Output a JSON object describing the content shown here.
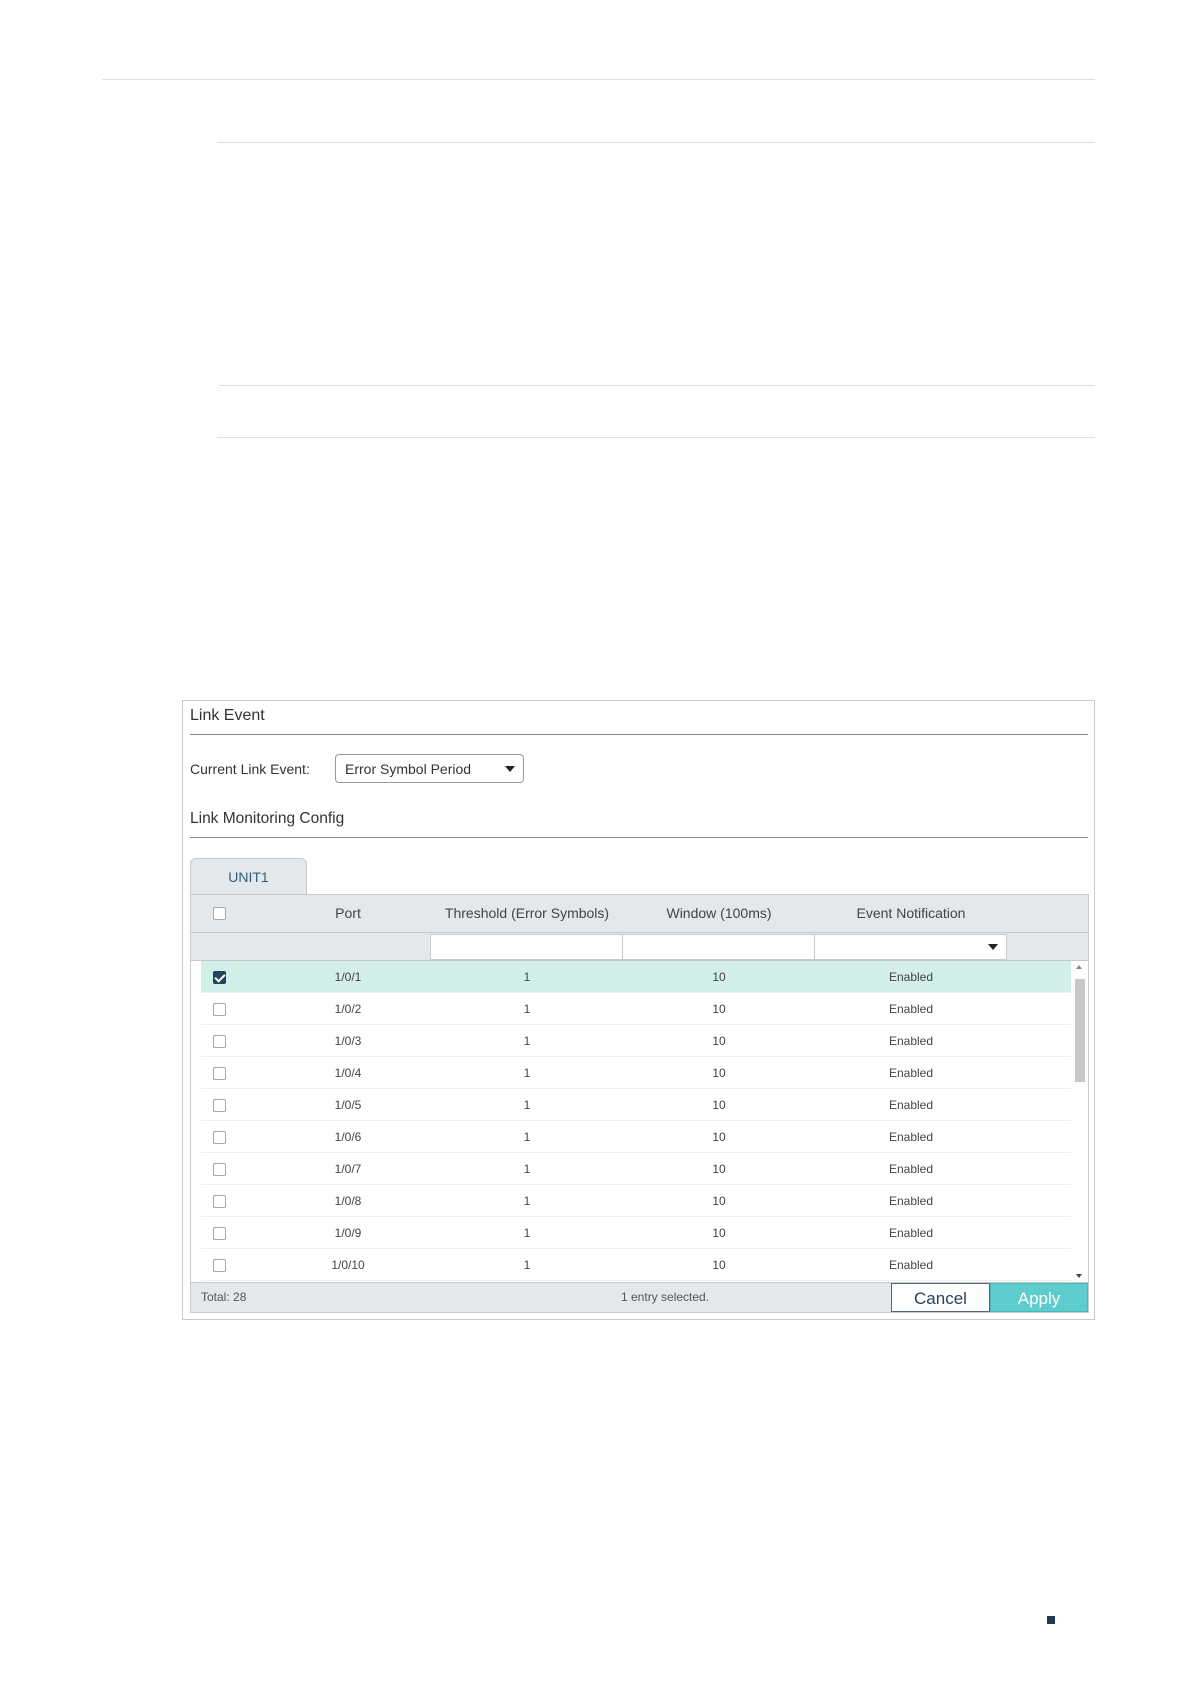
{
  "panel": {
    "title": "Link Event",
    "current_link_event": {
      "label": "Current Link Event:",
      "value": "Error Symbol Period"
    },
    "config_title": "Link Monitoring Config"
  },
  "tab": {
    "label": "UNIT1"
  },
  "table": {
    "headers": {
      "port": "Port",
      "threshold": "Threshold (Error Symbols)",
      "window": "Window (100ms)",
      "notification": "Event Notification"
    },
    "rows": [
      {
        "port": "1/0/1",
        "threshold": "1",
        "window": "10",
        "notification": "Enabled",
        "checked": true
      },
      {
        "port": "1/0/2",
        "threshold": "1",
        "window": "10",
        "notification": "Enabled",
        "checked": false
      },
      {
        "port": "1/0/3",
        "threshold": "1",
        "window": "10",
        "notification": "Enabled",
        "checked": false
      },
      {
        "port": "1/0/4",
        "threshold": "1",
        "window": "10",
        "notification": "Enabled",
        "checked": false
      },
      {
        "port": "1/0/5",
        "threshold": "1",
        "window": "10",
        "notification": "Enabled",
        "checked": false
      },
      {
        "port": "1/0/6",
        "threshold": "1",
        "window": "10",
        "notification": "Enabled",
        "checked": false
      },
      {
        "port": "1/0/7",
        "threshold": "1",
        "window": "10",
        "notification": "Enabled",
        "checked": false
      },
      {
        "port": "1/0/8",
        "threshold": "1",
        "window": "10",
        "notification": "Enabled",
        "checked": false
      },
      {
        "port": "1/0/9",
        "threshold": "1",
        "window": "10",
        "notification": "Enabled",
        "checked": false
      },
      {
        "port": "1/0/10",
        "threshold": "1",
        "window": "10",
        "notification": "Enabled",
        "checked": false
      }
    ],
    "footer": {
      "total": "Total: 28",
      "selection": "1 entry selected.",
      "cancel_label": "Cancel",
      "apply_label": "Apply"
    }
  }
}
